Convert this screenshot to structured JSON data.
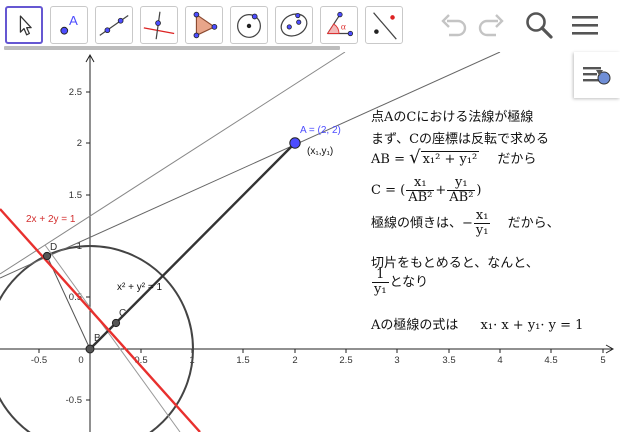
{
  "toolbar": {
    "tools": [
      {
        "id": "move",
        "icon": "move-arrow-icon",
        "active": true
      },
      {
        "id": "point",
        "icon": "point-tool-icon",
        "label": "A"
      },
      {
        "id": "line",
        "icon": "line-tool-icon"
      },
      {
        "id": "perpendicular",
        "icon": "perpendicular-line-icon"
      },
      {
        "id": "polygon",
        "icon": "polygon-tool-icon"
      },
      {
        "id": "circle",
        "icon": "circle-center-point-icon"
      },
      {
        "id": "conic",
        "icon": "ellipse-tool-icon"
      },
      {
        "id": "angle",
        "icon": "angle-tool-icon",
        "label": "α"
      },
      {
        "id": "reflect",
        "icon": "reflect-about-line-icon"
      }
    ],
    "right_buttons": [
      "undo-icon",
      "redo-icon",
      "search-icon",
      "menu-icon"
    ]
  },
  "colors": {
    "accent": "#6557d2",
    "point_a": "#4d4dff",
    "point_label_a": "#4d4dff",
    "tangent_line": "#e8302e",
    "tangent_label": "#d32f2f",
    "axis": "#222222",
    "circle": "#444444",
    "segment": "#333333",
    "thin_line": "#888888"
  },
  "graph": {
    "x_ticks": [
      "-0.5",
      "0",
      "0.5",
      "1",
      "1.5",
      "2",
      "2.5",
      "3",
      "3.5",
      "4",
      "4.5",
      "5"
    ],
    "y_ticks": [
      "2.5",
      "2",
      "1.5",
      "1",
      "0.5",
      "-0.5"
    ],
    "circle_label": "x² + y² = 1",
    "line_label": "2x + 2y = 1",
    "point_a_label": "A = (2, 2)",
    "point_a_coord_label": "(x₁,y₁)",
    "point_b_label": "B",
    "point_c_label": "C",
    "point_d_label": "D"
  },
  "notes": {
    "line1": "点AのCにおける法線が極線",
    "line2": "まず、Cの座標は反転で求める",
    "ab_prefix": "AB =",
    "ab_radicand": "x₁² + y₁²",
    "ab_suffix": "だから",
    "c_prefix": "C = (",
    "c_frac1_num": "x₁",
    "c_frac1_den": "AB²",
    "c_plus": "+",
    "c_frac2_num": "y₁",
    "c_frac2_den": "AB²",
    "c_suffix": ")",
    "slope_prefix": "極線の傾きは、−",
    "slope_num": "x₁",
    "slope_den": "y₁",
    "slope_suffix": "だから、",
    "intercept_text": "切片をもとめると、なんと、",
    "intercept_num": "1",
    "intercept_den": "y₁",
    "intercept_suffix": "となり",
    "polar_prefix": "Aの極線の式は",
    "polar_equation": "x₁· x + y₁· y = 1"
  }
}
